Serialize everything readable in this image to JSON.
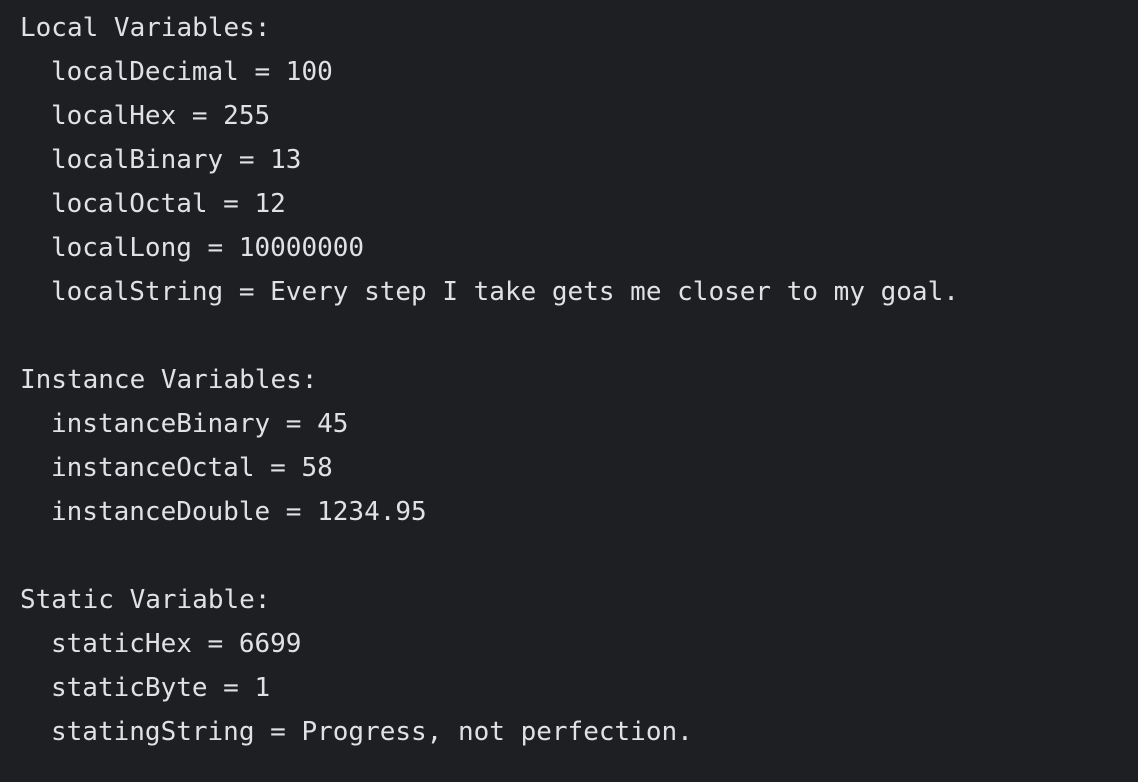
{
  "console": {
    "sections": [
      {
        "header": "Local Variables:",
        "lines": [
          "localDecimal = 100",
          "localHex = 255",
          "localBinary = 13",
          "localOctal = 12",
          "localLong = 10000000",
          "localString = Every step I take gets me closer to my goal."
        ]
      },
      {
        "header": "Instance Variables:",
        "lines": [
          "instanceBinary = 45",
          "instanceOctal = 58",
          "instanceDouble = 1234.95"
        ]
      },
      {
        "header": "Static Variable:",
        "lines": [
          "staticHex = 6699",
          "staticByte = 1",
          "statingString = Progress, not perfection."
        ]
      }
    ]
  },
  "colors": {
    "background": "#1e1f22",
    "text": "#dfe1e5"
  }
}
